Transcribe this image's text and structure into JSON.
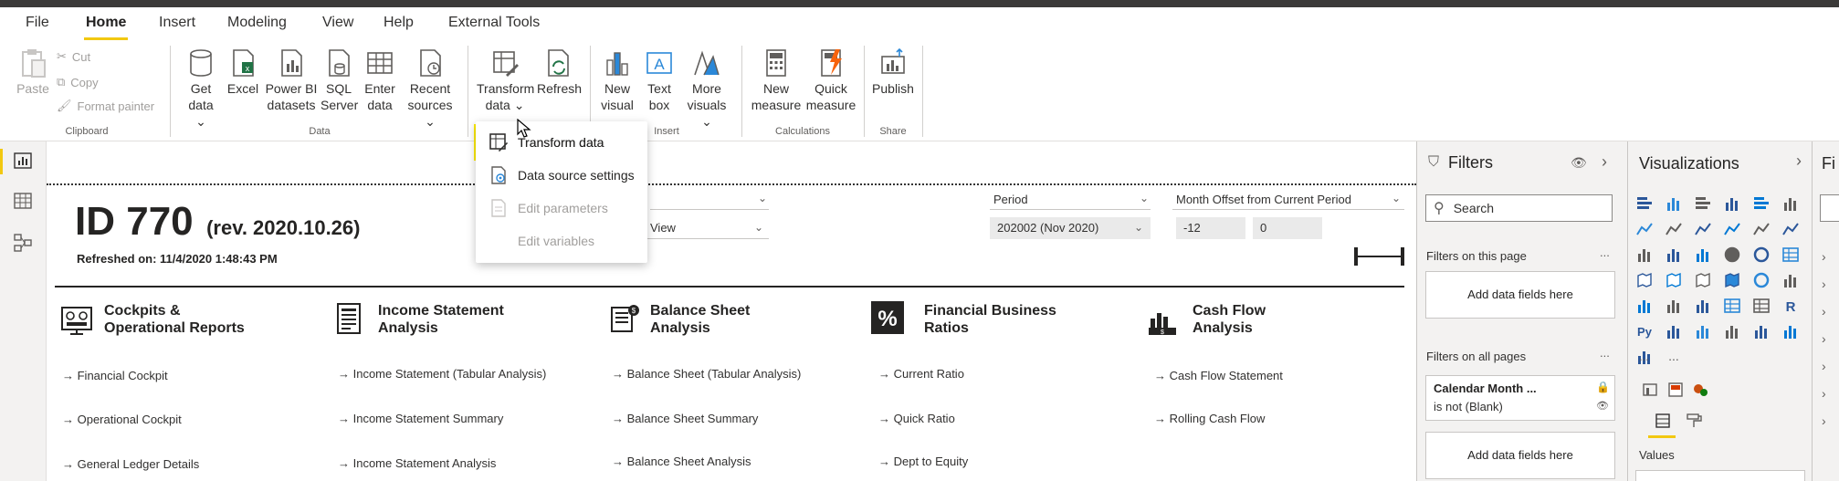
{
  "menu": {
    "tabs": [
      "File",
      "Home",
      "Insert",
      "Modeling",
      "View",
      "Help",
      "External Tools"
    ],
    "active_tab": "Home"
  },
  "ribbon": {
    "clipboard": {
      "paste": "Paste",
      "cut": "Cut",
      "copy": "Copy",
      "format_painter": "Format painter",
      "group_label": "Clipboard"
    },
    "data": {
      "get_data_1": "Get",
      "get_data_2": "data",
      "excel": "Excel",
      "pbi_1": "Power BI",
      "pbi_2": "datasets",
      "sql_1": "SQL",
      "sql_2": "Server",
      "enter_1": "Enter",
      "enter_2": "data",
      "recent_1": "Recent",
      "recent_2": "sources",
      "group_label": "Data"
    },
    "queries": {
      "transform_1": "Transform",
      "transform_2": "data",
      "refresh": "Refresh"
    },
    "insert": {
      "newvis_1": "New",
      "newvis_2": "visual",
      "textbox_1": "Text",
      "textbox_2": "box",
      "more_1": "More",
      "more_2": "visuals",
      "group_label": "Insert"
    },
    "calculations": {
      "newmeasure_1": "New",
      "newmeasure_2": "measure",
      "quick_1": "Quick",
      "quick_2": "measure",
      "group_label": "Calculations"
    },
    "share": {
      "publish": "Publish",
      "group_label": "Share"
    }
  },
  "dropdown": {
    "items": [
      "Transform data",
      "Data source settings",
      "Edit parameters",
      "Edit variables"
    ]
  },
  "report": {
    "title_id": "ID 770",
    "title_rev": "(rev. 2020.10.26)",
    "refreshed": "Refreshed on: 11/4/2020 1:48:43 PM",
    "view_value": "View",
    "period_label": "Period",
    "period_value": "202002 (Nov 2020)",
    "offset_label": "Month Offset from Current Period",
    "offset_min": "-12",
    "offset_max": "0",
    "sections": [
      {
        "title_1": "Cockpits &",
        "title_2": "Operational Reports",
        "links": [
          "→ Financial Cockpit",
          "→ Operational Cockpit",
          "→ General Ledger Details"
        ]
      },
      {
        "title_1": "Income Statement",
        "title_2": "Analysis",
        "links": [
          "→ Income Statement (Tabular Analysis)",
          "→ Income Statement Summary",
          "→ Income Statement Analysis"
        ]
      },
      {
        "title_1": "Balance Sheet",
        "title_2": "Analysis",
        "links": [
          "→ Balance Sheet (Tabular Analysis)",
          "→ Balance Sheet Summary",
          "→ Balance Sheet Analysis"
        ]
      },
      {
        "title_1": "Financial Business",
        "title_2": "Ratios",
        "links": [
          "→ Current Ratio",
          "→ Quick Ratio",
          "→ Dept to Equity"
        ]
      },
      {
        "title_1": "Cash Flow",
        "title_2": "Analysis",
        "links": [
          "→ Cash Flow Statement",
          "→ Rolling Cash Flow"
        ]
      }
    ]
  },
  "filters": {
    "title": "Filters",
    "search_placeholder": "Search",
    "on_this_page": "Filters on this page",
    "add_fields": "Add data fields here",
    "on_all_pages": "Filters on all pages",
    "card_title": "Calendar Month ...",
    "card_sub": "is not (Blank)",
    "add_fields_2": "Add data fields here",
    "more": "..."
  },
  "visualizations": {
    "title": "Visualizations",
    "values_label": "Values",
    "r_label": "R",
    "py_label": "Py",
    "more": "..."
  },
  "fields_strip": {
    "title": "Fi"
  },
  "colors": {
    "accent_yellow": "#f2c811",
    "highlight": "#ffed00",
    "pane_bg": "#f3f2f1",
    "icon_blue": "#2b579a"
  }
}
